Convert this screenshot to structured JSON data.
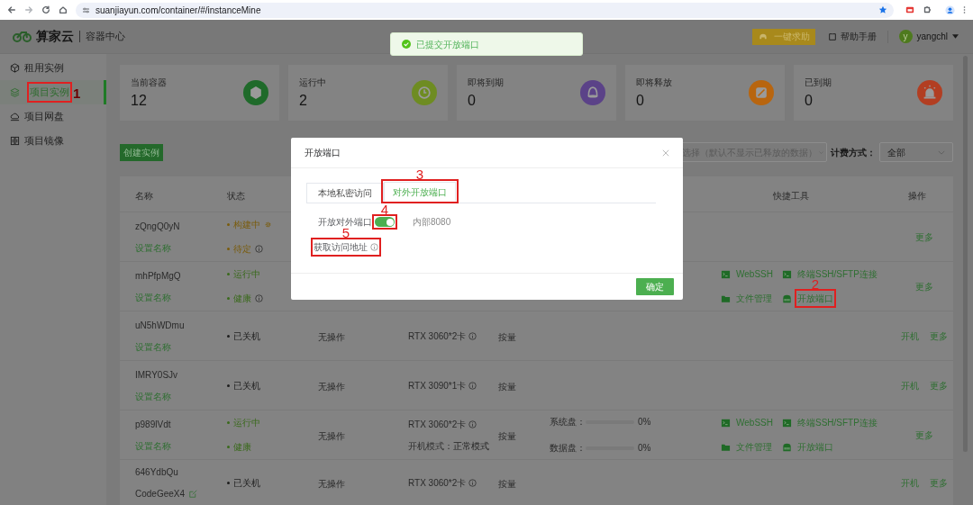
{
  "browser": {
    "url": "suanjiayun.com/container/#/instanceMine"
  },
  "header": {
    "brand": "算家云",
    "app_title": "容器中心",
    "help_button": "一键求助",
    "manual": "帮助手册",
    "user": {
      "initial": "y",
      "name": "yangchl"
    }
  },
  "toast": {
    "text": "已提交开放端口"
  },
  "sidebar": {
    "items": [
      {
        "label": "租用实例",
        "selected": false
      },
      {
        "label": "项目实例",
        "selected": true,
        "marker": "1"
      },
      {
        "label": "项目网盘",
        "selected": false
      },
      {
        "label": "项目镜像",
        "selected": false
      }
    ]
  },
  "stats": [
    {
      "label": "当前容器",
      "value": "12",
      "color": "#1f6a2a"
    },
    {
      "label": "运行中",
      "value": "2",
      "color": "#6e8c22"
    },
    {
      "label": "即将到期",
      "value": "0",
      "color": "#5b4288"
    },
    {
      "label": "即将释放",
      "value": "0",
      "color": "#b8650f"
    },
    {
      "label": "已到期",
      "value": "0",
      "color": "#b23e22"
    }
  ],
  "create_button": "创建实例",
  "filters": {
    "status_placeholder": "选择（默认不显示已释放的数据）",
    "billing_label": "计费方式：",
    "billing_value": "全部"
  },
  "table": {
    "columns": [
      "名称",
      "状态",
      "快捷工具",
      "操作"
    ],
    "rows": [
      {
        "name": "zQngQ0yN",
        "subtitle": {
          "text": "设置名称",
          "kind": "link"
        },
        "status": [
          {
            "text": "构建中",
            "color": "#7a5c0c",
            "kind": "building"
          },
          {
            "text": "待定",
            "color": "#7a5c0c",
            "kind": "info"
          }
        ],
        "actions": [
          "更多"
        ]
      },
      {
        "name": "mhPfpMgQ",
        "subtitle": {
          "text": "设置名称",
          "kind": "link"
        },
        "status": [
          {
            "text": "运行中",
            "color": "#3a6a1c",
            "kind": "plain"
          },
          {
            "text": "健康",
            "color": "#3a6a1c",
            "kind": "info"
          }
        ],
        "tools": [
          {
            "label": "WebSSH",
            "kind": "terminal"
          },
          {
            "label": "终端SSH/SFTP连接",
            "kind": "terminal"
          },
          {
            "label": "文件管理",
            "kind": "folder"
          },
          {
            "label": "开放端口",
            "kind": "port",
            "marker": "2"
          }
        ],
        "actions": [
          "更多"
        ]
      },
      {
        "name": "uN5hWDmu",
        "subtitle": {
          "text": "设置名称",
          "kind": "link"
        },
        "status": [
          {
            "text": "已关机",
            "color": "#1e1e1e",
            "kind": "plain"
          }
        ],
        "operation": "无操作",
        "gpu": "RTX 3060*2卡",
        "billing": "按量",
        "actions": [
          "开机",
          "更多"
        ]
      },
      {
        "name": "IMRY0SJv",
        "subtitle": {
          "text": "设置名称",
          "kind": "link"
        },
        "status": [
          {
            "text": "已关机",
            "color": "#1e1e1e",
            "kind": "plain"
          }
        ],
        "operation": "无操作",
        "gpu": "RTX 3090*1卡",
        "billing": "按量",
        "actions": [
          "开机",
          "更多"
        ]
      },
      {
        "name": "p989lVdt",
        "subtitle": {
          "text": "设置名称",
          "kind": "link"
        },
        "status": [
          {
            "text": "运行中",
            "color": "#3a6a1c",
            "kind": "plain"
          },
          {
            "text": "健康",
            "color": "#3a6a1c",
            "kind": "plain"
          }
        ],
        "operation": "无操作",
        "gpu": "RTX 3060*2卡",
        "boot_mode": {
          "label": "开机模式：",
          "value": "正常模式"
        },
        "billing": "按量",
        "disks": [
          {
            "label": "系统盘：",
            "level": 0,
            "reading": "0%"
          },
          {
            "label": "数据盘：",
            "level": 0,
            "reading": "0%"
          }
        ],
        "tools": [
          {
            "label": "WebSSH",
            "kind": "terminal"
          },
          {
            "label": "终端SSH/SFTP连接",
            "kind": "terminal"
          },
          {
            "label": "文件管理",
            "kind": "folder"
          },
          {
            "label": "开放端口",
            "kind": "port"
          }
        ],
        "actions": [
          "更多"
        ]
      },
      {
        "name": "646YdbQu",
        "subtitle": {
          "text": "CodeGeeX4",
          "kind": "editable"
        },
        "status": [
          {
            "text": "已关机",
            "color": "#1e1e1e",
            "kind": "plain"
          }
        ],
        "operation": "无操作",
        "gpu": "RTX 3060*2卡",
        "billing": "按量",
        "actions": [
          "开机",
          "更多"
        ]
      }
    ]
  },
  "modal": {
    "title": "开放端口",
    "tabs": [
      {
        "label": "本地私密访问",
        "selected": false
      },
      {
        "label": "对外开放端口",
        "selected": true,
        "marker": "3"
      }
    ],
    "switch": {
      "label": "开放对外端口",
      "on": true,
      "marker": "4"
    },
    "port_note": "内部8080",
    "link": {
      "label": "获取访问地址",
      "marker": "5"
    },
    "confirm": "确定"
  }
}
